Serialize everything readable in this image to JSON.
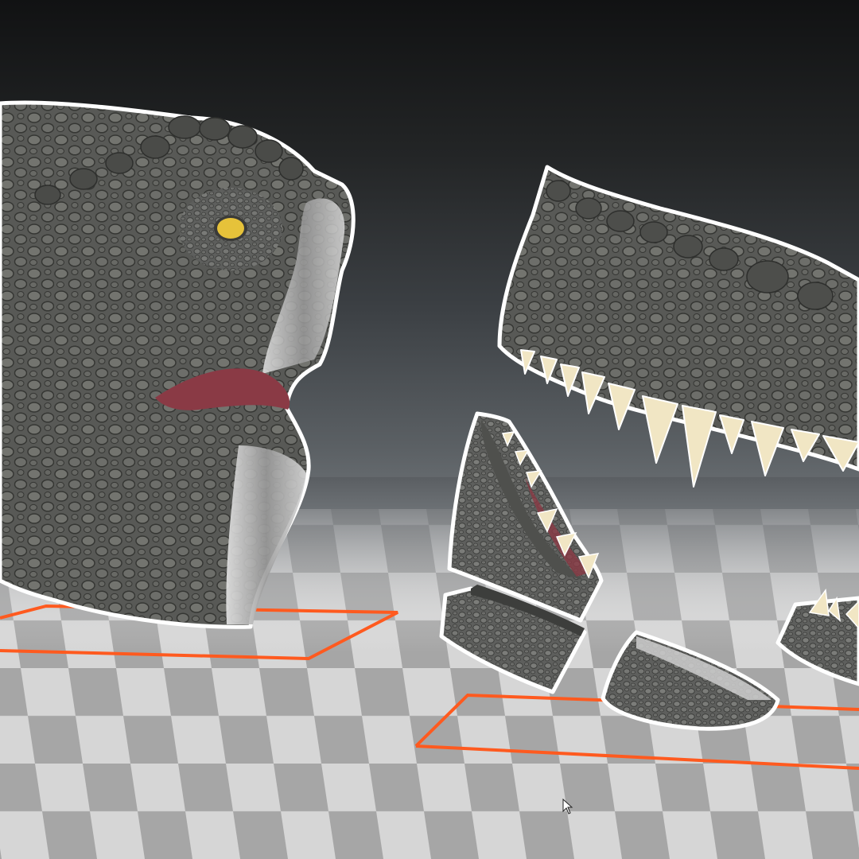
{
  "app": {
    "title": "",
    "view": "3D viewport"
  },
  "scene": {
    "parts": [
      {
        "name": "dinosaur-head-upper"
      },
      {
        "name": "dinosaur-snout-upper-jaw"
      },
      {
        "name": "lower-jaw-piece-left"
      },
      {
        "name": "lower-jaw-piece-bottom"
      },
      {
        "name": "lower-jaw-piece-front"
      },
      {
        "name": "lower-jaw-piece-right"
      }
    ],
    "selection_outline_color": "#ffffff",
    "bounding_box_color": "#ff5a1f",
    "floor_light_color": "#d9d9d9",
    "floor_dark_color": "#a9a9a9",
    "skin_color": "#6d6d6b",
    "eye_color": "#e6c23a",
    "teeth_color": "#f1e6c4",
    "mouth_color": "#8a3a45"
  },
  "cursor": {
    "icon": "arrow-cursor-icon"
  }
}
